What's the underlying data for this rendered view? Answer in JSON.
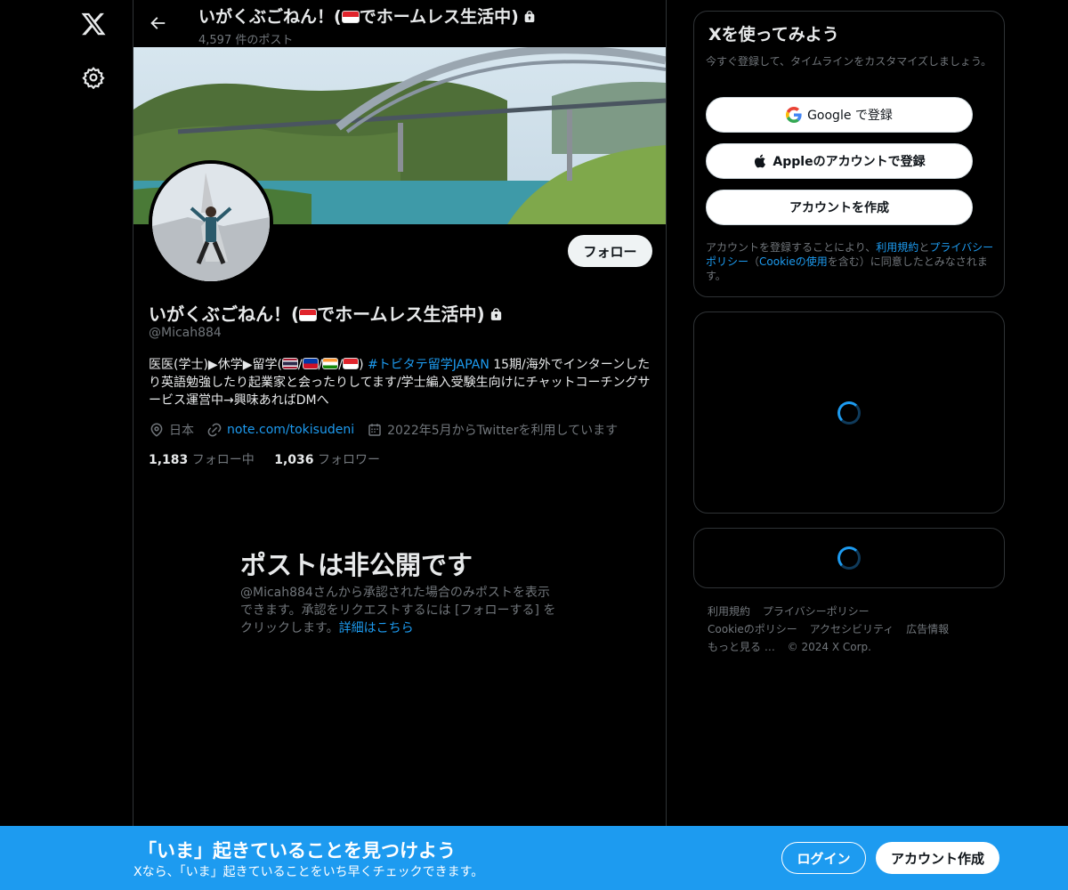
{
  "header": {
    "name_part1": "いがくぶごねん！(",
    "name_part2": "でホームレス生活中)",
    "post_count": "4,597 件のポスト"
  },
  "profile": {
    "name_part1": "いがくぶごねん！(",
    "name_part2": "でホームレス生活中)",
    "handle": "@Micah884",
    "follow_label": "フォロー",
    "bio_part1": "医医(学士)▶休学▶留学(",
    "bio_sep": "/",
    "bio_close": ")",
    "bio_hashtag": "#トビタテ留学JAPAN",
    "bio_part2": " 15期/海外でインターンしたり英語勉強したり起業家と会ったりしてます/学士編入受験生向けにチャットコーチングサービス運営中→興味あればDMへ",
    "location": "日本",
    "website": "note.com/tokisudeni",
    "joined": "2022年5月からTwitterを利用しています",
    "following_count": "1,183",
    "following_label": "フォロー中",
    "followers_count": "1,036",
    "followers_label": "フォロワー"
  },
  "private": {
    "title": "ポストは非公開です",
    "text": "@Micah884さんから承認された場合のみポストを表示できます。承認をリクエストするには [フォローする] をクリックします。",
    "more_link": "詳細はこちら"
  },
  "signup": {
    "title": "Xを使ってみよう",
    "desc": "今すぐ登録して、タイムラインをカスタマイズしましょう。",
    "google": "Google で登録",
    "apple": "Appleのアカウントで登録",
    "create": "アカウントを作成",
    "terms_1": "アカウントを登録することにより、",
    "terms_link1": "利用規約",
    "terms_2": "と",
    "terms_link2": "プライバシーポリシー",
    "terms_3": "（",
    "terms_link3": "Cookieの使用",
    "terms_4": "を含む）に同意したとみなされます。"
  },
  "footer": {
    "links": [
      "利用規約",
      "プライバシーポリシー",
      "Cookieのポリシー",
      "アクセシビリティ",
      "広告情報",
      "もっと見る …",
      "© 2024 X Corp."
    ]
  },
  "bottom_bar": {
    "title": "「いま」起きていることを見つけよう",
    "subtitle": "Xなら、「いま」起きていることをいち早くチェックできます。",
    "login": "ログイン",
    "create": "アカウント作成"
  },
  "colors": {
    "accent": "#1d9bf0",
    "background": "#000000",
    "border": "#2f3336",
    "muted_text": "#71767b"
  },
  "icons": [
    "x-logo-icon",
    "gear-icon",
    "back-arrow-icon",
    "lock-icon",
    "singapore-flag-icon",
    "thailand-flag-icon",
    "philippines-flag-icon",
    "india-flag-icon",
    "location-icon",
    "link-icon",
    "calendar-icon",
    "google-icon",
    "apple-icon",
    "loading-spinner-icon"
  ]
}
